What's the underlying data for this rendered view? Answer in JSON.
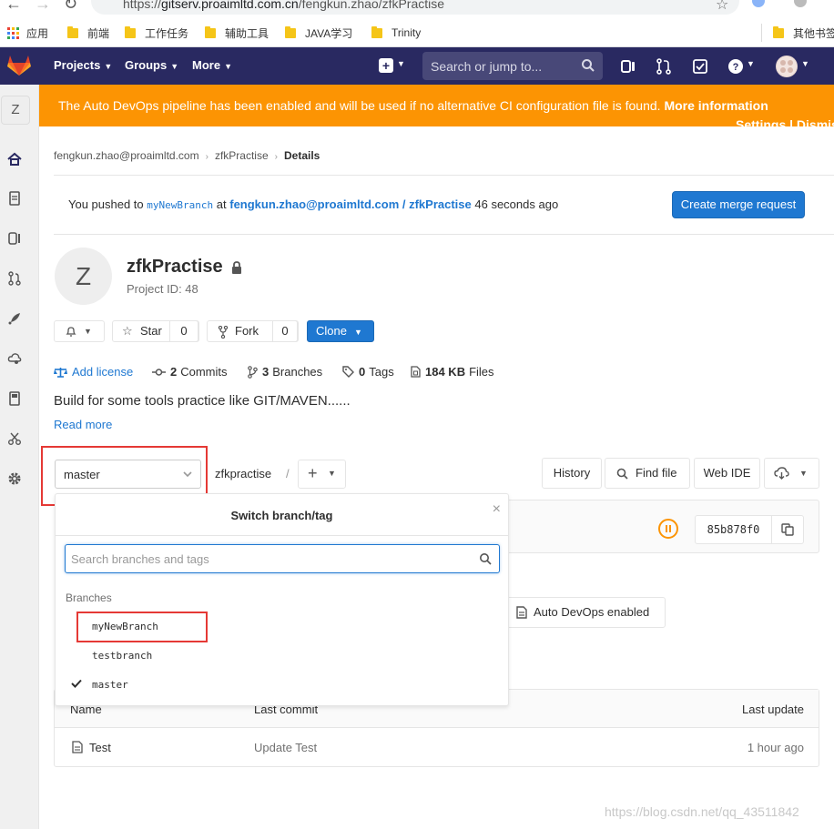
{
  "browser": {
    "url_prefix": "https://",
    "url_host": "gitserv.proaimltd.com.cn",
    "url_path": "/fengkun.zhao/zfkPractise",
    "bookmarks": [
      "应用",
      "前端",
      "工作任务",
      "辅助工具",
      "JAVA学习",
      "Trinity",
      "其他书签"
    ]
  },
  "header": {
    "nav": [
      "Projects",
      "Groups",
      "More"
    ],
    "search_placeholder": "Search or jump to...",
    "brand_color": "#292961"
  },
  "sidebar": {
    "project_initial": "Z"
  },
  "banner": {
    "message": "The Auto DevOps pipeline has been enabled and will be used if no alternative CI configuration file is found.",
    "more_info": "More information",
    "actions": "Settings | Dismiss",
    "color": "#fc9403"
  },
  "breadcrumb": {
    "owner": "fengkun.zhao@proaimltd.com",
    "project": "zfkPractise",
    "current": "Details"
  },
  "push_notice": {
    "prefix": "You pushed to",
    "branch": "myNewBranch",
    "at": "at",
    "target": "fengkun.zhao@proaimltd.com / zfkPractise",
    "time": "46 seconds ago",
    "button": "Create merge request"
  },
  "project": {
    "initial": "Z",
    "name": "zfkPractise",
    "id_text": "Project ID: 48",
    "star_label": "Star",
    "star_count": "0",
    "fork_label": "Fork",
    "fork_count": "0",
    "clone_label": "Clone"
  },
  "stats": {
    "add_license": "Add license",
    "commits_n": "2",
    "commits_label": "Commits",
    "branches_n": "3",
    "branches_label": "Branches",
    "tags_n": "0",
    "tags_label": "Tags",
    "files_n": "184 KB",
    "files_label": "Files"
  },
  "description": "Build for some tools practice like GIT/MAVEN......",
  "read_more": "Read more",
  "repo": {
    "branch": "master",
    "path": "zfkpractise",
    "path_sep": "/",
    "history": "History",
    "find_file": "Find file",
    "web_ide": "Web IDE",
    "sha": "85b878f0",
    "auto_devops": "Auto DevOps enabled"
  },
  "dropdown": {
    "title": "Switch branch/tag",
    "search_placeholder": "Search branches and tags",
    "section": "Branches",
    "items": [
      "myNewBranch",
      "testbranch",
      "master"
    ],
    "selected": "master"
  },
  "files": {
    "headers": [
      "Name",
      "Last commit",
      "Last update"
    ],
    "rows": [
      {
        "name": "Test",
        "commit": "Update Test",
        "update": "1 hour ago"
      }
    ]
  },
  "watermark": "https://blog.csdn.net/qq_43511842"
}
